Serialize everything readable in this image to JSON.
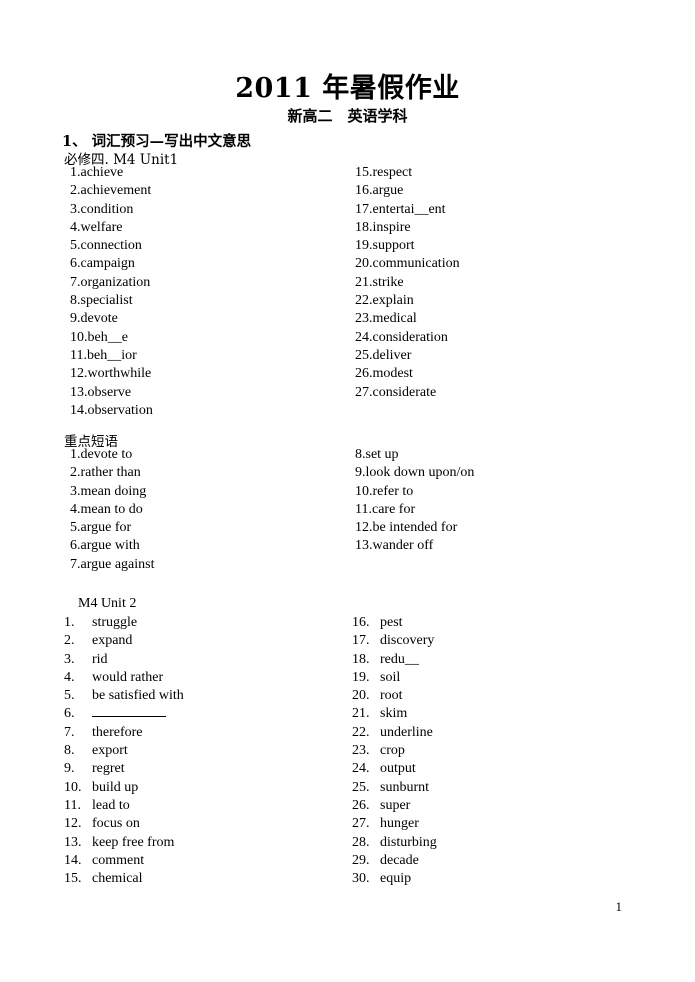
{
  "document": {
    "title": "2011 年暑假作业",
    "subtitle": "新高二　英语学科",
    "page_number": "1"
  },
  "section": {
    "heading": "1、 词汇预习—写出中文意思",
    "book_line": "必修四. M4 Unit1",
    "phrases_heading": "重点短语",
    "unit2_heading": "M4 Unit 2"
  },
  "unit1_words": {
    "left": [
      "1.achieve",
      "2.achievement",
      "3.condition",
      "4.welfare",
      "5.connection",
      "6.campaign",
      "7.organization",
      "8.specialist",
      "9.devote",
      "10.beh__e",
      "11.beh__ior",
      "12.worthwhile",
      "13.observe",
      "14.observation"
    ],
    "right": [
      "15.respect",
      "16.argue",
      "17.entertai__ent",
      "18.inspire",
      "19.support",
      "20.communication",
      "21.strike",
      "22.explain",
      "23.medical",
      "24.consideration",
      "25.deliver",
      "26.modest",
      "27.considerate"
    ]
  },
  "unit1_phrases": {
    "left": [
      "1.devote to",
      "2.rather than",
      "3.mean doing",
      "4.mean to do",
      "5.argue for",
      "6.argue with",
      "7.argue against"
    ],
    "right": [
      "8.set up",
      "9.look down upon/on",
      "10.refer to",
      "11.care for",
      "12.be intended for",
      "13.wander off"
    ]
  },
  "unit2_words": {
    "left": [
      {
        "num": "1.",
        "text": "struggle"
      },
      {
        "num": "2.",
        "text": "expand"
      },
      {
        "num": "3.",
        "text": "rid"
      },
      {
        "num": "4.",
        "text": "would rather"
      },
      {
        "num": "5.",
        "text": "be satisfied with"
      },
      {
        "num": "6.",
        "text": "",
        "blank": true
      },
      {
        "num": "7.",
        "text": "therefore"
      },
      {
        "num": "8.",
        "text": "export"
      },
      {
        "num": "9.",
        "text": "regret"
      },
      {
        "num": "10.",
        "text": "build up"
      },
      {
        "num": "11.",
        "text": "lead to"
      },
      {
        "num": "12.",
        "text": "focus on"
      },
      {
        "num": "13.",
        "text": "keep free from"
      },
      {
        "num": "14.",
        "text": "comment"
      },
      {
        "num": "15.",
        "text": "chemical"
      }
    ],
    "right": [
      {
        "num": "16.",
        "text": "pest"
      },
      {
        "num": "17.",
        "text": "discovery"
      },
      {
        "num": "18.",
        "text": "redu__"
      },
      {
        "num": "19.",
        "text": "soil"
      },
      {
        "num": "20.",
        "text": "root"
      },
      {
        "num": "21.",
        "text": "skim"
      },
      {
        "num": "22.",
        "text": "underline"
      },
      {
        "num": "23.",
        "text": "crop"
      },
      {
        "num": "24.",
        "text": "output"
      },
      {
        "num": "25.",
        "text": "sunburnt"
      },
      {
        "num": "26.",
        "text": "super"
      },
      {
        "num": "27.",
        "text": "hunger"
      },
      {
        "num": "28.",
        "text": "disturbing"
      },
      {
        "num": "29.",
        "text": "decade"
      },
      {
        "num": "30.",
        "text": "equip"
      }
    ]
  }
}
